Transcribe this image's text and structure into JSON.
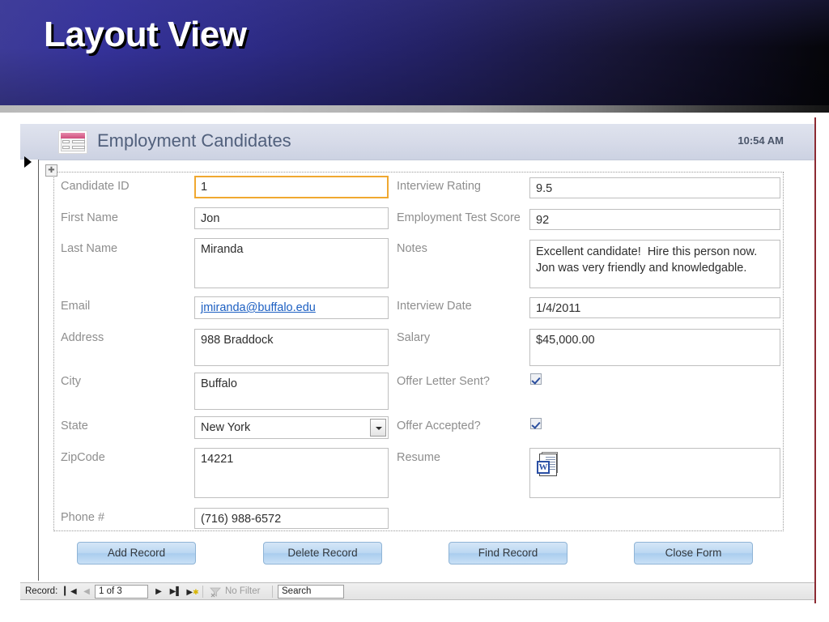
{
  "slide": {
    "title": "Layout View"
  },
  "form": {
    "header": {
      "icon": "form-icon",
      "title": "Employment Candidates",
      "time": "10:54 AM"
    },
    "fields_left": [
      {
        "label": "Candidate ID",
        "value": "1",
        "type": "text",
        "focused": true
      },
      {
        "label": "First Name",
        "value": "Jon",
        "type": "text",
        "focused": false
      },
      {
        "label": "Last Name",
        "value": "Miranda",
        "type": "textarea",
        "focused": false
      },
      {
        "label": "Email",
        "value": "jmiranda@buffalo.edu",
        "type": "link",
        "focused": false
      },
      {
        "label": "Address",
        "value": "988 Braddock",
        "type": "textarea",
        "focused": false
      },
      {
        "label": "City",
        "value": "Buffalo",
        "type": "textarea",
        "focused": false
      },
      {
        "label": "State",
        "value": "New York",
        "type": "combobox",
        "focused": false
      },
      {
        "label": "ZipCode",
        "value": "14221",
        "type": "textarea",
        "focused": false
      },
      {
        "label": "Phone #",
        "value": "(716) 988-6572",
        "type": "text",
        "focused": false
      }
    ],
    "fields_right": [
      {
        "label": "Interview Rating",
        "value": "9.5",
        "type": "text"
      },
      {
        "label": "Employment Test Score",
        "value": "92",
        "type": "text"
      },
      {
        "label": "Notes",
        "value": "Excellent candidate!  Hire this person now.   Jon was very friendly and knowledgable.",
        "type": "textarea"
      },
      {
        "label": "Interview Date",
        "value": "1/4/2011",
        "type": "text"
      },
      {
        "label": "Salary",
        "value": "$45,000.00",
        "type": "textarea"
      },
      {
        "label": "Offer Letter Sent?",
        "value": "checked",
        "type": "checkbox"
      },
      {
        "label": "Offer Accepted?",
        "value": "checked",
        "type": "checkbox"
      },
      {
        "label": "Resume",
        "value": "W",
        "type": "attachment"
      }
    ],
    "buttons": [
      {
        "label": "Add Record"
      },
      {
        "label": "Delete Record"
      },
      {
        "label": "Find Record"
      },
      {
        "label": "Close Form"
      }
    ],
    "navigation": {
      "record_label": "Record:",
      "position": "1 of 3",
      "first_icon": "first-record-icon",
      "previous_icon": "previous-record-icon",
      "next_icon": "next-record-icon",
      "last_icon": "last-record-icon",
      "new_icon": "new-record-icon",
      "filter_icon": "filter-icon",
      "filter_label": "No Filter",
      "search_value": "Search"
    }
  },
  "colors": {
    "banner_start": "#3d3b98",
    "banner_end": "#050509",
    "focus_border": "#f0a830",
    "link": "#1c5fc2",
    "label": "#8e8e8e",
    "form_title": "#51607c",
    "button": "#bcd8f2",
    "accent_red_line": "#8c2b33"
  }
}
